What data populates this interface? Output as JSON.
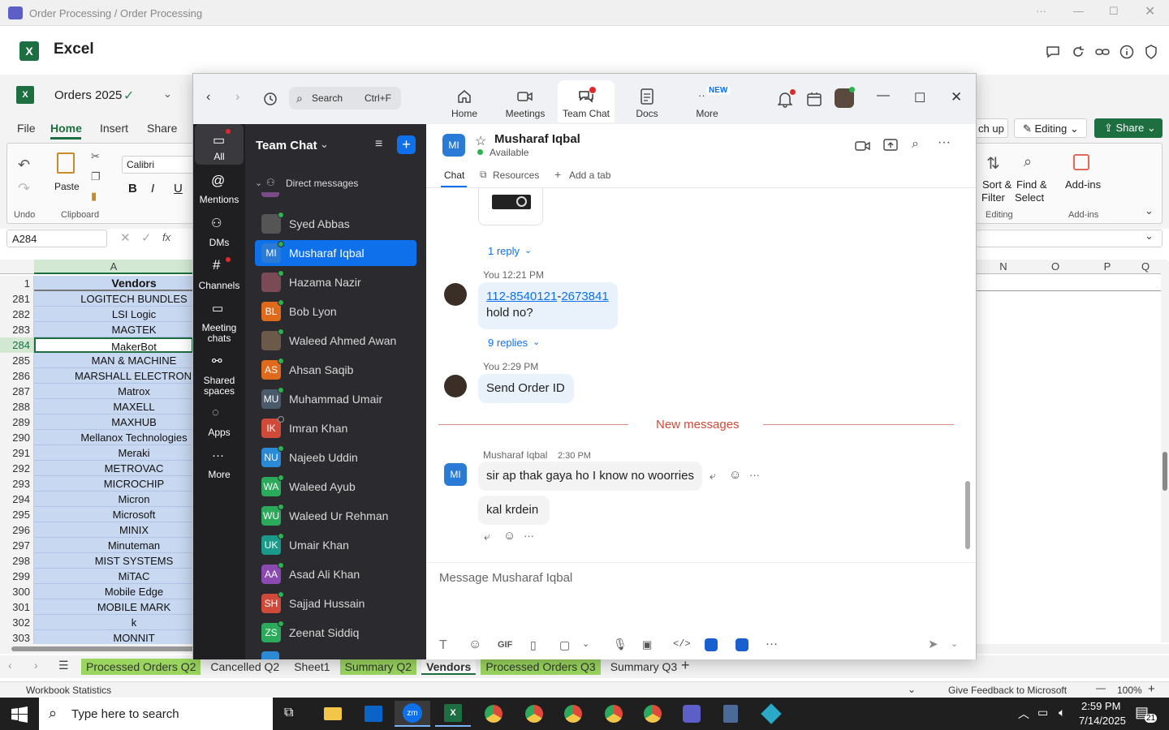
{
  "teams_titlebar": {
    "title": "Order Processing / Order Processing"
  },
  "excel": {
    "app_name": "Excel",
    "file_name": "Orders 2025",
    "ribbon_tabs": [
      "File",
      "Home",
      "Insert",
      "Share"
    ],
    "undo_label": "Undo",
    "paste_label": "Paste",
    "clipboard_label": "Clipboard",
    "font_name": "Calibri",
    "catch_up_label": "ch up",
    "editing_label": "Editing",
    "share_label": "Share",
    "sort_label": "Sort &",
    "sort_label2": "Filter",
    "find_label": "Find &",
    "find_label2": "Select",
    "editing_group": "Editing",
    "addins_label": "Add-ins",
    "addins_group": "Add-ins",
    "name_box": "A284",
    "col_a": "A",
    "right_cols": [
      "N",
      "O",
      "P",
      "Q"
    ],
    "header_row": {
      "num": "1",
      "value": "Vendors"
    },
    "rows": [
      {
        "num": "281",
        "value": "LOGITECH BUNDLES"
      },
      {
        "num": "282",
        "value": "LSI Logic"
      },
      {
        "num": "283",
        "value": "MAGTEK"
      },
      {
        "num": "284",
        "value": "MakerBot"
      },
      {
        "num": "285",
        "value": "MAN & MACHINE"
      },
      {
        "num": "286",
        "value": "MARSHALL ELECTRONICS"
      },
      {
        "num": "287",
        "value": "Matrox"
      },
      {
        "num": "288",
        "value": "MAXELL"
      },
      {
        "num": "289",
        "value": "MAXHUB"
      },
      {
        "num": "290",
        "value": "Mellanox Technologies"
      },
      {
        "num": "291",
        "value": "Meraki"
      },
      {
        "num": "292",
        "value": "METROVAC"
      },
      {
        "num": "293",
        "value": "MICROCHIP"
      },
      {
        "num": "294",
        "value": "Micron"
      },
      {
        "num": "295",
        "value": "Microsoft"
      },
      {
        "num": "296",
        "value": "MINIX"
      },
      {
        "num": "297",
        "value": "Minuteman"
      },
      {
        "num": "298",
        "value": "MIST SYSTEMS"
      },
      {
        "num": "299",
        "value": "MiTAC"
      },
      {
        "num": "300",
        "value": "Mobile Edge"
      },
      {
        "num": "301",
        "value": "MOBILE MARK"
      },
      {
        "num": "302",
        "value": "k"
      },
      {
        "num": "303",
        "value": "MONNIT"
      }
    ],
    "sheet_tabs": [
      {
        "label": "Processed Orders Q2",
        "green": true
      },
      {
        "label": "Cancelled Q2",
        "green": false
      },
      {
        "label": "Sheet1",
        "green": false
      },
      {
        "label": "Summary Q2",
        "green": true
      },
      {
        "label": "Vendors",
        "green": false
      },
      {
        "label": "Processed Orders Q3",
        "green": true
      },
      {
        "label": "Summary Q3",
        "green": false
      }
    ],
    "status_left": "Workbook Statistics",
    "status_feedback": "Give Feedback to Microsoft",
    "zoom_level": "100%"
  },
  "zoom": {
    "search_placeholder": "Search",
    "search_shortcut": "Ctrl+F",
    "nav_tabs": [
      "Home",
      "Meetings",
      "Team Chat",
      "Docs",
      "More"
    ],
    "new_badge": "NEW",
    "rail": [
      "All",
      "Mentions",
      "DMs",
      "Channels",
      "Meeting chats",
      "Shared spaces",
      "Apps",
      "More"
    ],
    "list_title": "Team Chat",
    "section_label": "Direct messages",
    "contacts": [
      {
        "name": "Syed Abbas",
        "initials": "",
        "color": "#555555"
      },
      {
        "name": "Musharaf Iqbal",
        "initials": "MI",
        "color": "#2a7bd6"
      },
      {
        "name": "Hazama Nazir",
        "initials": "",
        "color": "#7a4a55"
      },
      {
        "name": "Bob Lyon",
        "initials": "BL",
        "color": "#e06a1c"
      },
      {
        "name": "Waleed Ahmed Awan",
        "initials": "",
        "color": "#6b5a4a"
      },
      {
        "name": "Ahsan Saqib",
        "initials": "AS",
        "color": "#e06a1c"
      },
      {
        "name": "Muhammad Umair",
        "initials": "MU",
        "color": "#4a5a6a"
      },
      {
        "name": "Imran Khan",
        "initials": "IK",
        "color": "#d04a3a"
      },
      {
        "name": "Najeeb Uddin",
        "initials": "NU",
        "color": "#2a8ad6"
      },
      {
        "name": "Waleed Ayub",
        "initials": "WA",
        "color": "#2aaa5a"
      },
      {
        "name": "Waleed Ur Rehman",
        "initials": "WU",
        "color": "#2aaa5a"
      },
      {
        "name": "Umair Khan",
        "initials": "UK",
        "color": "#1a9a8a"
      },
      {
        "name": "Asad Ali Khan",
        "initials": "AA",
        "color": "#8a4ab0"
      },
      {
        "name": "Sajjad Hussain",
        "initials": "SH",
        "color": "#d04a3a"
      },
      {
        "name": "Zeenat Siddiq",
        "initials": "ZS",
        "color": "#2aaa5a"
      }
    ],
    "chat_header": {
      "name": "Musharaf Iqbal",
      "initials": "MI",
      "status": "Available",
      "tabs": [
        "Chat",
        "Resources",
        "Add a tab"
      ]
    },
    "messages": {
      "reply_1": "1 reply",
      "you_1_meta": "You 12:21 PM",
      "phone_part1": "112-8540121",
      "phone_sep": "-",
      "phone_part2": "2673841",
      "msg_hold": "hold no?",
      "replies_9": "9 replies",
      "you_2_meta": "You 2:29 PM",
      "msg_send": "Send Order ID",
      "new_messages": "New messages",
      "mi_sender": "Musharaf Iqbal",
      "mi_time": "2:30 PM",
      "msg_sir": "sir ap thak gaya ho I know no woorries",
      "msg_kal": "kal krdein"
    },
    "composer_placeholder": "Message Musharaf Iqbal",
    "gif_label": "GIF"
  },
  "taskbar": {
    "search_placeholder": "Type here to search",
    "time": "2:59 PM",
    "date": "7/14/2025",
    "notif_count": "21"
  }
}
